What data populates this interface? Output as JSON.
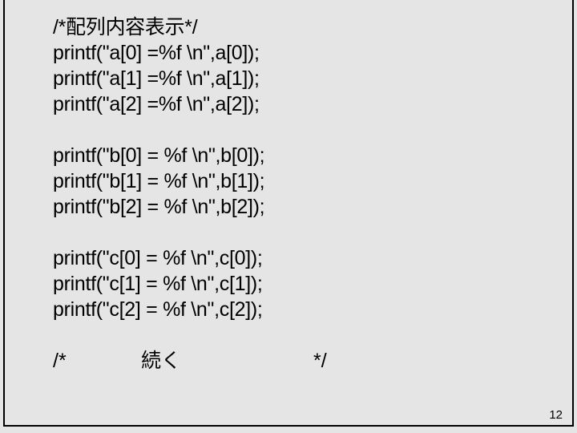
{
  "code": {
    "comment": "/*配列内容表示*/",
    "a0": "printf(\"a[0] =%f \\n\",a[0]);",
    "a1": "printf(\"a[1] =%f \\n\",a[1]);",
    "a2": "printf(\"a[2] =%f \\n\",a[2]);",
    "b0": "printf(\"b[0] = %f \\n\",b[0]);",
    "b1": "printf(\"b[1] = %f \\n\",b[1]);",
    "b2": "printf(\"b[2] = %f \\n\",b[2]);",
    "c0": "printf(\"c[0] = %f \\n\",c[0]);",
    "c1": "printf(\"c[1] = %f \\n\",c[1]);",
    "c2": "printf(\"c[2] = %f \\n\",c[2]);",
    "tail_open": "/*",
    "tail_mid": "続く",
    "tail_close": "*/"
  },
  "page_number": "12"
}
